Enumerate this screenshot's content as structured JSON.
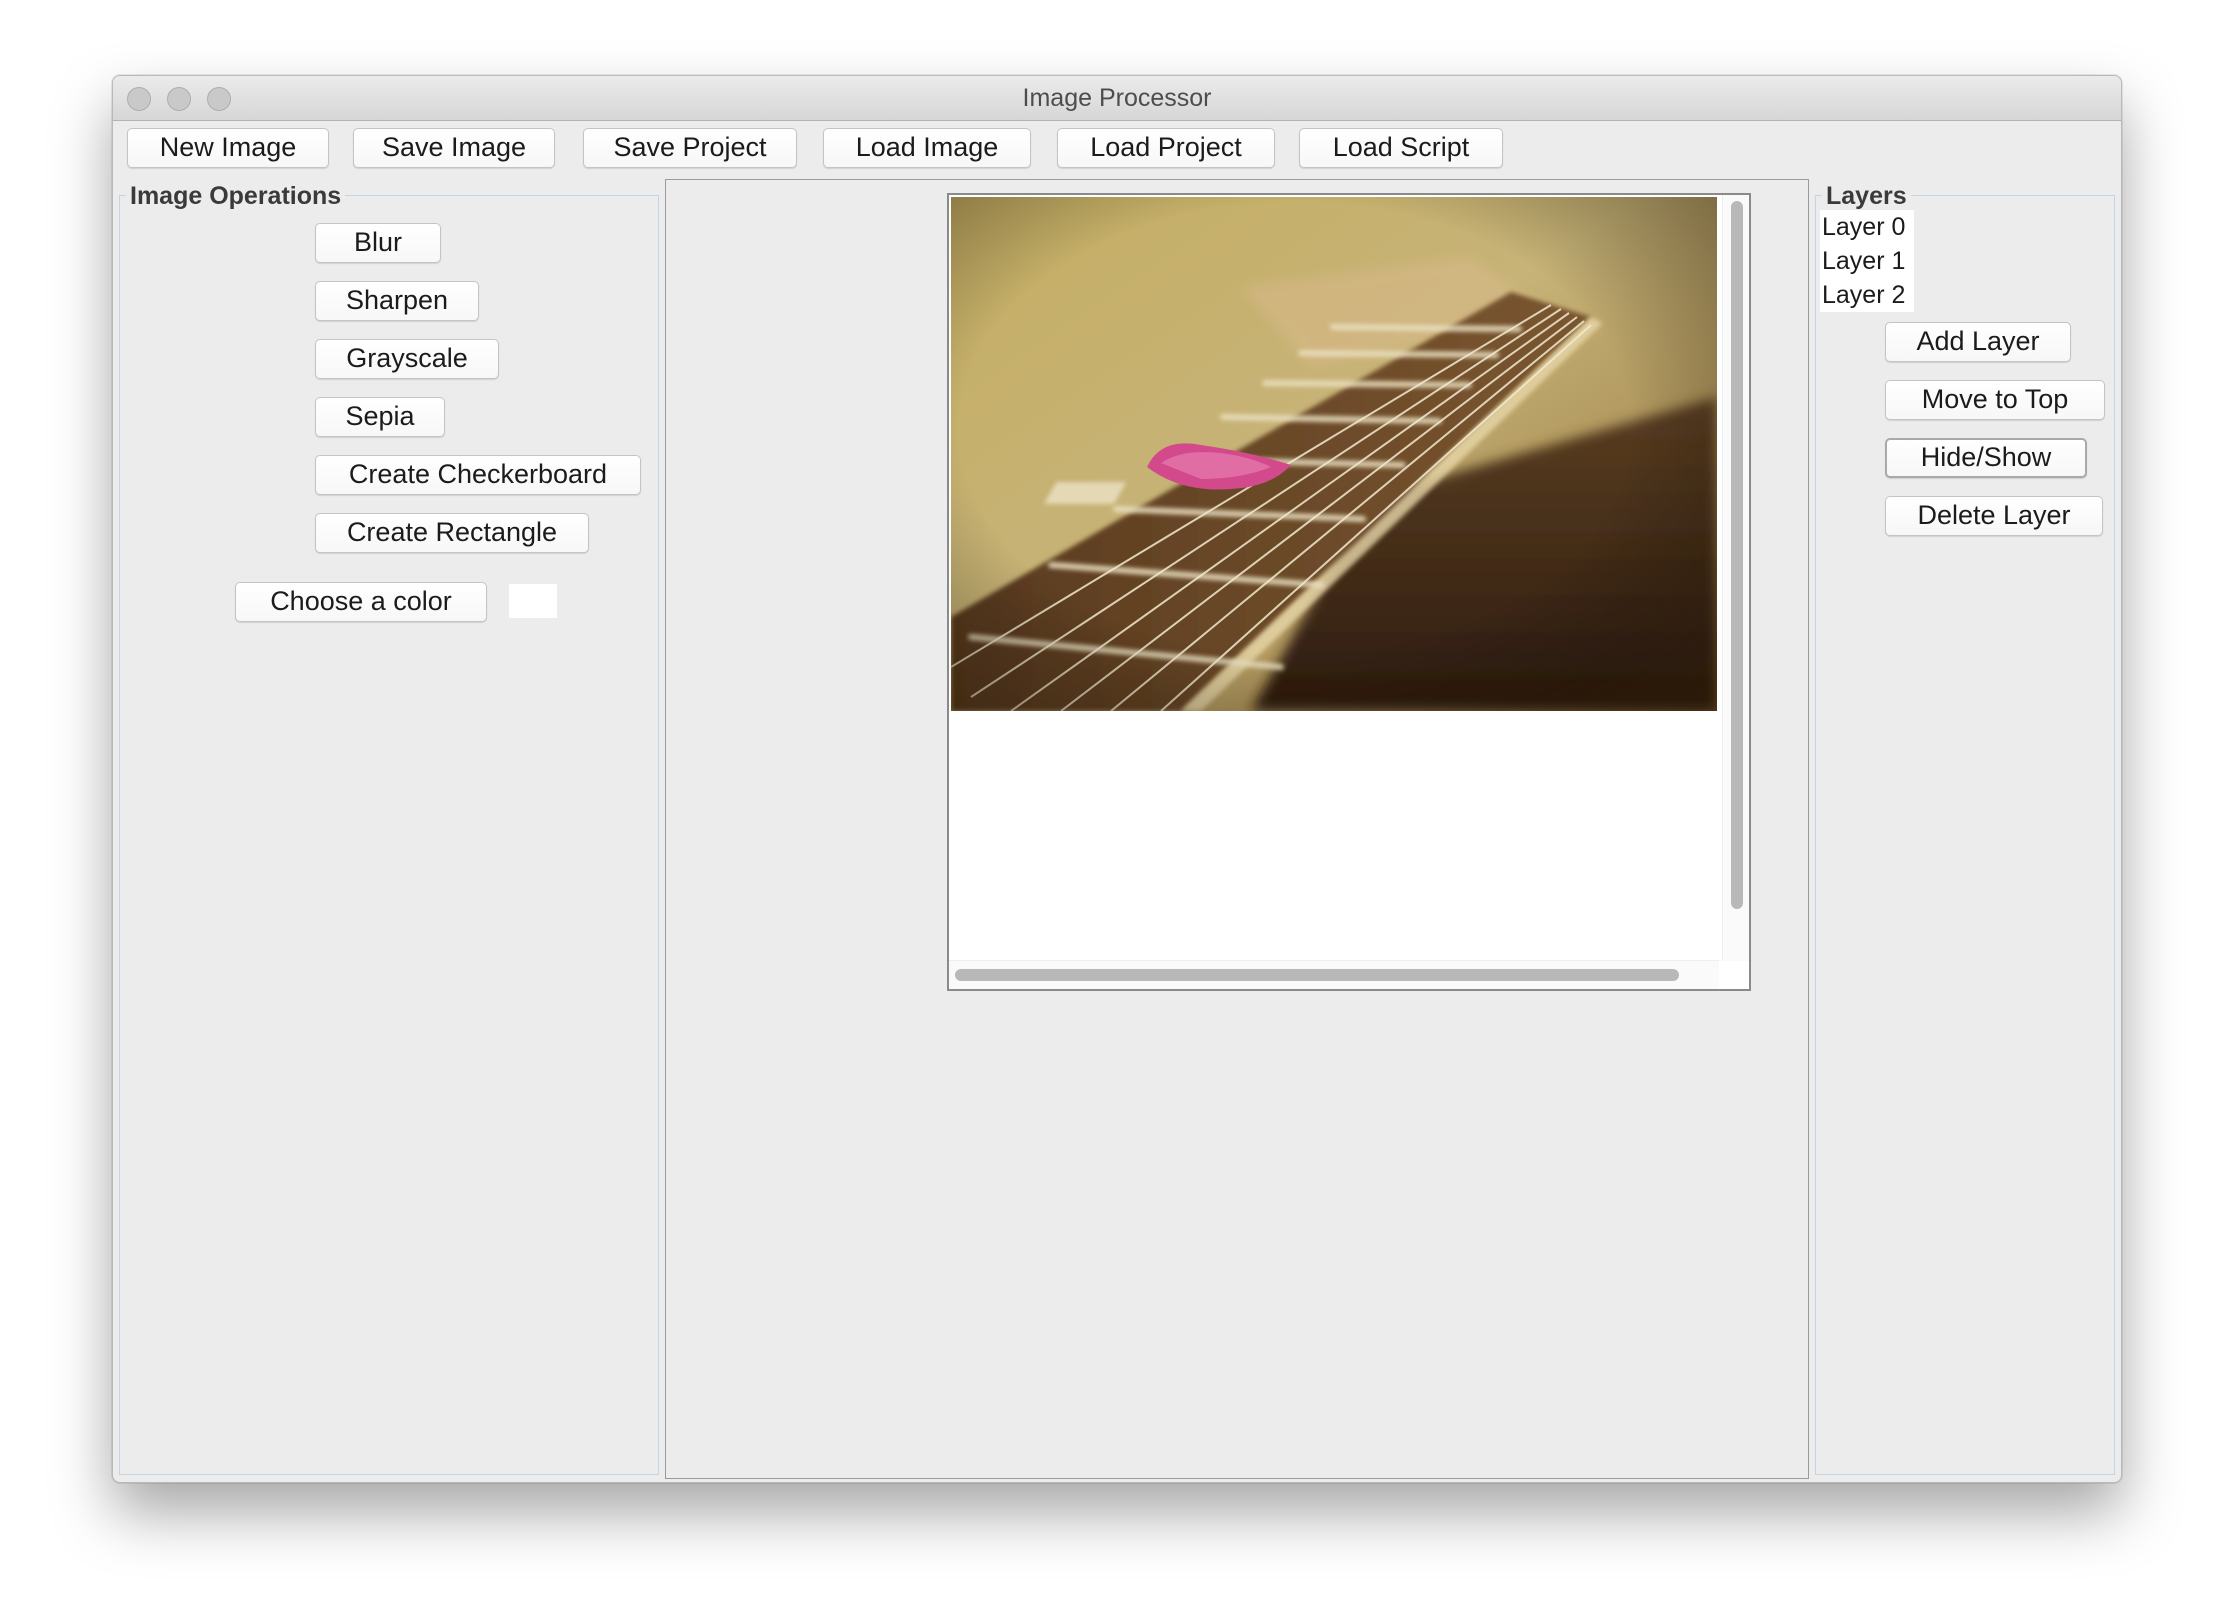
{
  "window": {
    "title": "Image Processor"
  },
  "toolbar": {
    "new_image": "New Image",
    "save_image": "Save Image",
    "save_project": "Save Project",
    "load_image": "Load Image",
    "load_project": "Load Project",
    "load_script": "Load Script"
  },
  "operations": {
    "title": "Image Operations",
    "blur": "Blur",
    "sharpen": "Sharpen",
    "grayscale": "Grayscale",
    "sepia": "Sepia",
    "create_checkerboard": "Create Checkerboard",
    "create_rectangle": "Create Rectangle",
    "choose_color": "Choose a color",
    "selected_color": "#ffffff"
  },
  "layers": {
    "title": "Layers",
    "items": [
      "Layer 0",
      "Layer 1",
      "Layer 2"
    ],
    "add_layer": "Add Layer",
    "move_to_top": "Move to Top",
    "hide_show": "Hide/Show",
    "delete_layer": "Delete Layer"
  },
  "canvas": {
    "image_subject": "guitar fretboard with pink pick"
  }
}
